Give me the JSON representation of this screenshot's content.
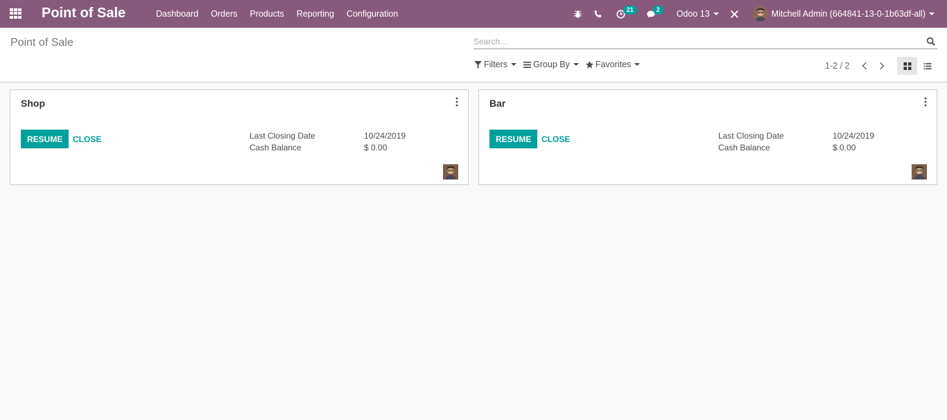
{
  "navbar": {
    "app_title": "Point of Sale",
    "menu": [
      "Dashboard",
      "Orders",
      "Products",
      "Reporting",
      "Configuration"
    ],
    "activity_count": "21",
    "message_count": "2",
    "database": "Odoo 13",
    "user": "Mitchell Admin (664841-13-0-1b63df-all)"
  },
  "control_panel": {
    "breadcrumb": "Point of Sale",
    "search_placeholder": "Search...",
    "filters_label": "Filters",
    "groupby_label": "Group By",
    "favorites_label": "Favorites",
    "pager": "1-2 / 2"
  },
  "cards": [
    {
      "title": "Shop",
      "resume_label": "RESUME",
      "close_label": "CLOSE",
      "closing_date_label": "Last Closing Date",
      "closing_date": "10/24/2019",
      "cash_balance_label": "Cash Balance",
      "cash_balance": "$ 0.00"
    },
    {
      "title": "Bar",
      "resume_label": "RESUME",
      "close_label": "CLOSE",
      "closing_date_label": "Last Closing Date",
      "closing_date": "10/24/2019",
      "cash_balance_label": "Cash Balance",
      "cash_balance": "$ 0.00"
    }
  ],
  "colors": {
    "navbar": "#875a7b",
    "accent": "#00a09d",
    "background": "#f9f9f9"
  },
  "icons": [
    "apps-icon",
    "bug-icon",
    "phone-icon",
    "activity-clock-icon",
    "chat-icon",
    "close-x-icon",
    "search-icon",
    "filter-icon",
    "list-bars-icon",
    "star-icon",
    "chevron-left-icon",
    "chevron-right-icon",
    "kanban-view-icon",
    "list-view-icon",
    "vertical-dots-icon"
  ]
}
